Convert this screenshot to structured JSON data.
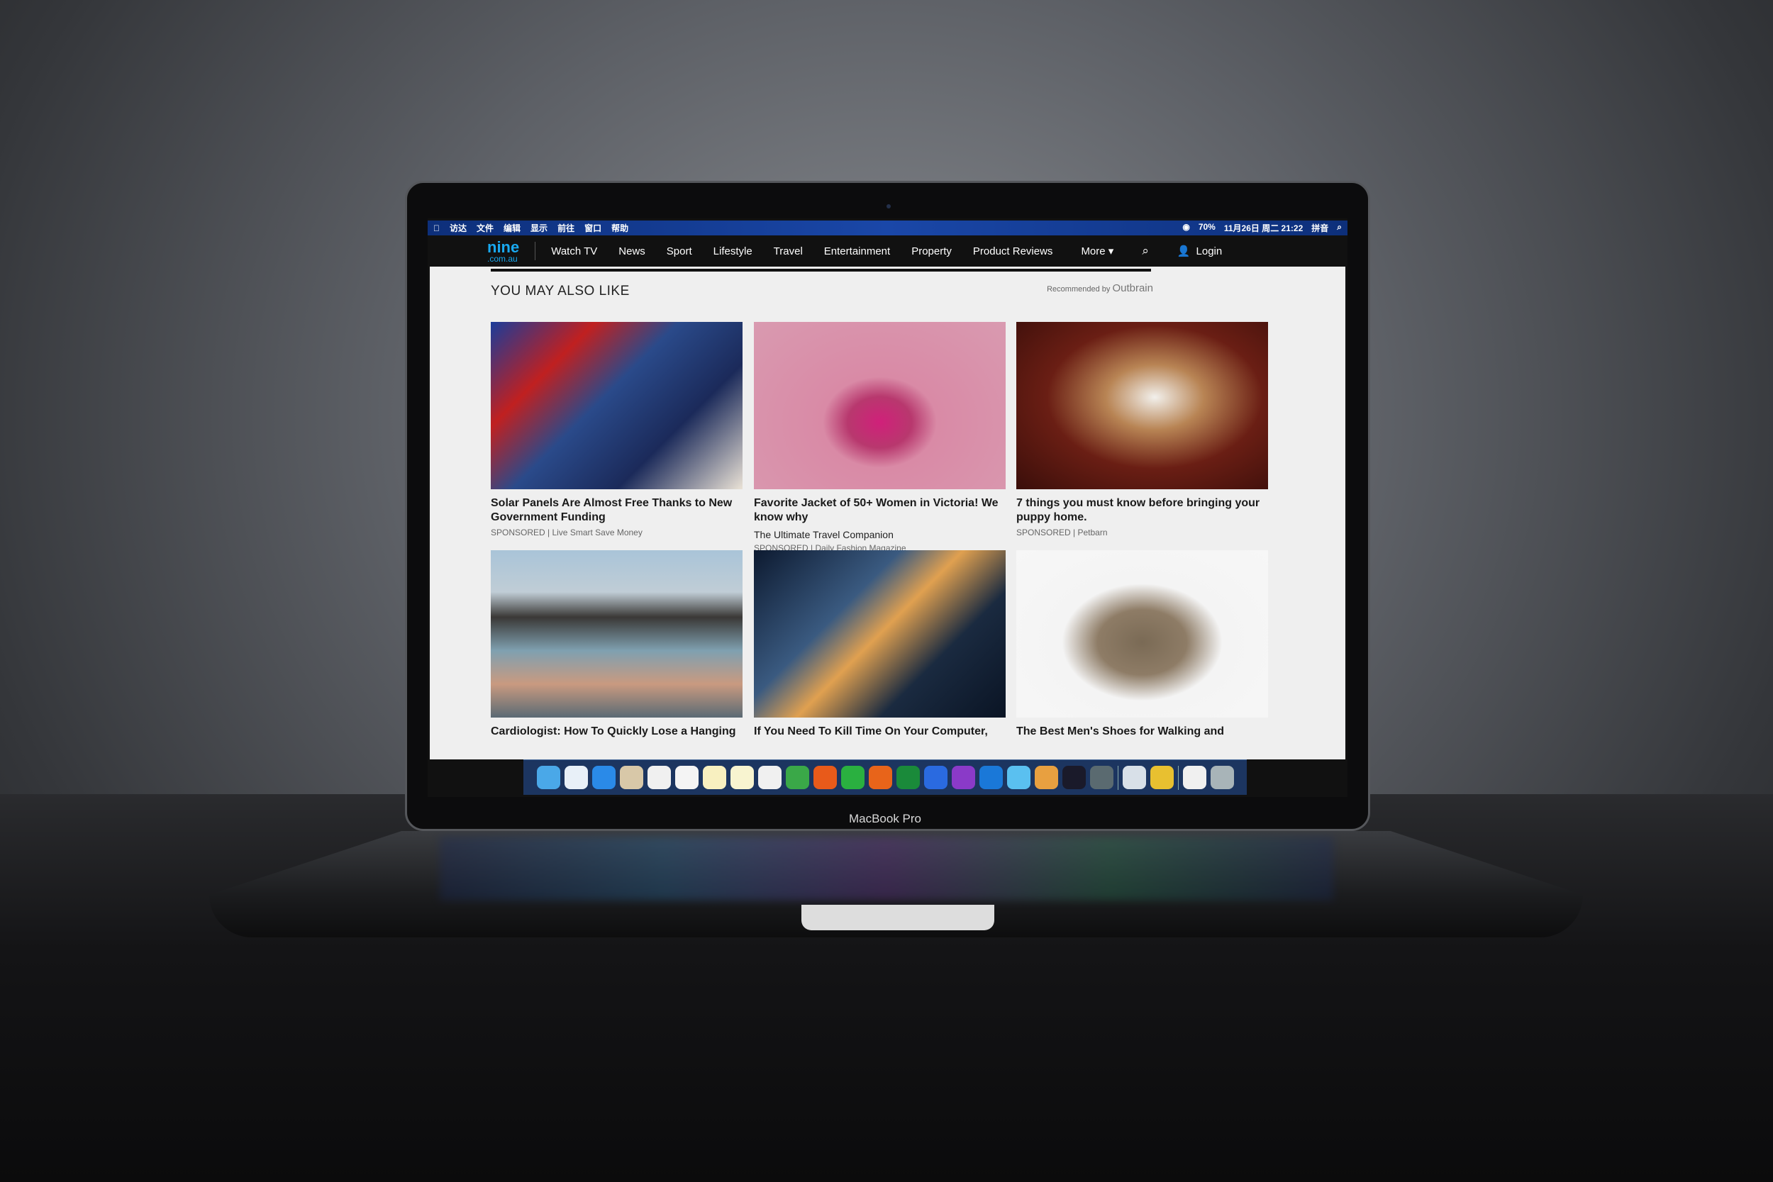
{
  "device": {
    "label": "MacBook Pro"
  },
  "menubar": {
    "left_items": [
      "",
      "访达",
      "文件",
      "编辑",
      "显示",
      "前往",
      "窗口",
      "帮助"
    ],
    "right_items": [
      "70%",
      "11月26日 周二 21:22",
      "拼音"
    ]
  },
  "nav": {
    "logo": "nine",
    "logo_sub": ".com.au",
    "items": [
      "Watch TV",
      "News",
      "Sport",
      "Lifestyle",
      "Travel",
      "Entertainment",
      "Property",
      "Product Reviews"
    ],
    "more": "More ▾",
    "search_icon": "search-icon",
    "login": "Login",
    "accent": "#19a9f0"
  },
  "section": {
    "heading": "YOU MAY ALSO LIKE",
    "recommended": "Recommended by",
    "provider": "Outbrain"
  },
  "cards": [
    {
      "title": "Solar Panels Are Almost Free Thanks to New Government Funding",
      "spon": "SPONSORED | Live Smart Save Money",
      "img": "linear-gradient(135deg,#1a3c9a 0%,#c02020 25%,#2a4a8a 45%,#1b2a5a 70%,#eae2d6 100%)"
    },
    {
      "title": "Favorite Jacket of 50+ Women in Victoria! We know why",
      "sub": "The Ultimate Travel Companion",
      "spon": "SPONSORED | Daily Fashion Magazine",
      "img": "radial-gradient(ellipse at 50% 60%,#d0207a 0%,#b8386e 18%,#d98aa6 32%,#d99ab0 100%)"
    },
    {
      "title": "7 things you must know before bringing your puppy home.",
      "spon": "SPONSORED | Petbarn",
      "img": "radial-gradient(ellipse at 55% 45%,#f2f0ec 0%,#b88454 25%,#6a1e14 55%,#3a0e0a 100%)"
    },
    {
      "title": "Cardiologist: How To Quickly Lose a Hanging",
      "img": "linear-gradient(#a9c4d8 0%,#c0cdd6 25%,#3a3836 40%,#7fa0b0 60%,#c99a80 80%,#5a6a74 100%)"
    },
    {
      "title": "If You Need To Kill Time On Your Computer,",
      "img": "linear-gradient(135deg,#0d1a30 0%,#3a5a80 35%,#e0a050 50%,#1a2a40 70%,#0a1424 100%)"
    },
    {
      "title": "The Best Men's Shoes for Walking and",
      "img": "radial-gradient(ellipse at 50% 55%,#7a6a55 0%,#8e7c66 25%,#f4f4f4 45%,#f7f7f7 100%)"
    }
  ],
  "dock": {
    "icons": [
      "finder",
      "safari",
      "app-store",
      "preview",
      "calendar",
      "photos",
      "notes",
      "stickies",
      "music",
      "evernote",
      "netease",
      "wechat",
      "powerpoint",
      "excel",
      "word",
      "onenote",
      "outlook",
      "icloud",
      "final-cut",
      "infinity",
      "system-preferences",
      "image-viewer",
      "chrome",
      "document",
      "trash"
    ],
    "colors": [
      "#4aa8e8",
      "#e8f0f8",
      "#2a8ae8",
      "#d8c8a8",
      "#f0f0f0",
      "#f4f4f4",
      "#f8f0c0",
      "#f8f4d0",
      "#f0f0f0",
      "#3aa848",
      "#e85a1a",
      "#2ab040",
      "#e8641a",
      "#1a8a3a",
      "#2a6ae0",
      "#8a3ac8",
      "#1a78d8",
      "#5ac0f0",
      "#e8a040",
      "#1a1a2a",
      "#5a6a70",
      "#d8e0e8",
      "#e8c030",
      "#f0f0f0",
      "#a8b4b8"
    ]
  }
}
